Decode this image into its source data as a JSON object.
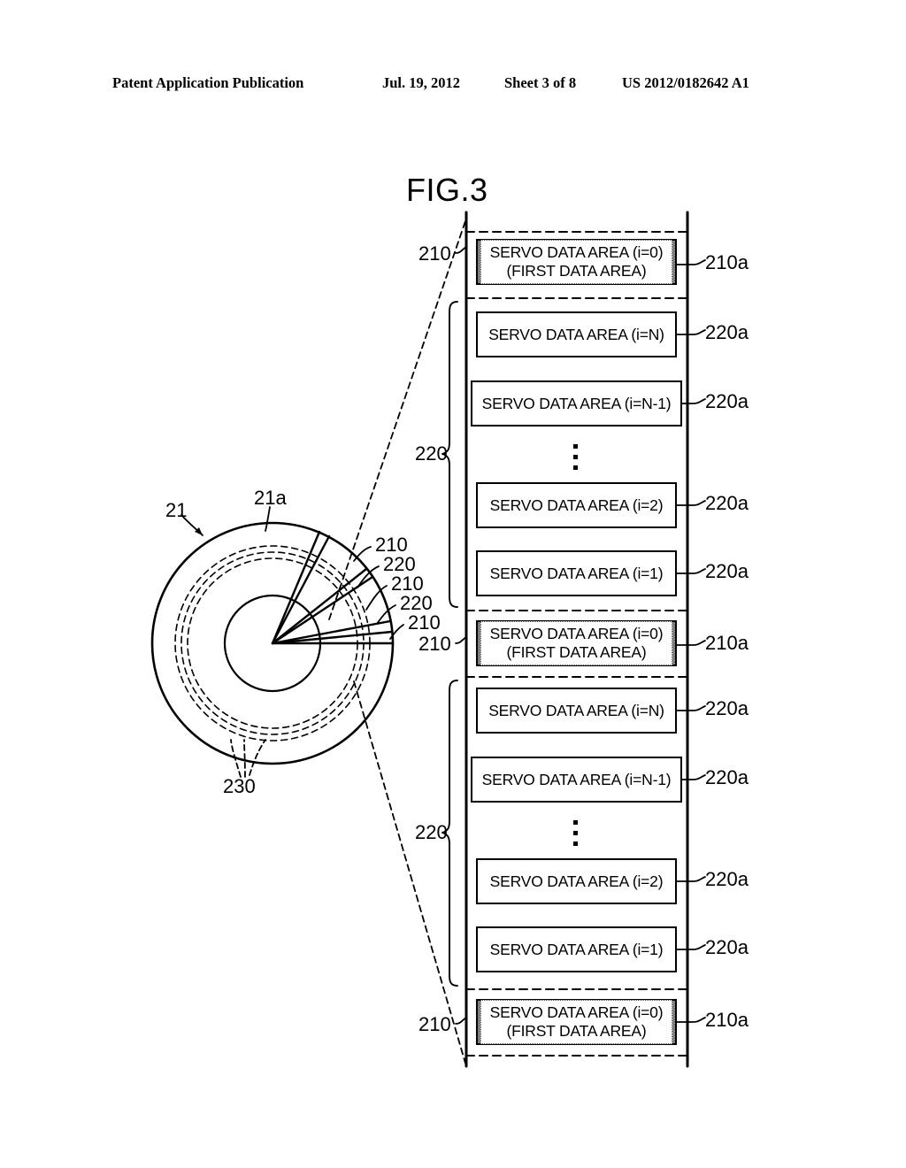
{
  "header": {
    "publication": "Patent Application Publication",
    "date": "Jul. 19, 2012",
    "sheet": "Sheet 3 of 8",
    "patent_number": "US 2012/0182642 A1"
  },
  "figure": {
    "title": "FIG.3"
  },
  "blocks": [
    {
      "id": "b1",
      "type": "shaded",
      "line1": "SERVO DATA AREA (i=0)",
      "line2": "(FIRST DATA AREA)",
      "right_label": "210a",
      "left_label": "210"
    },
    {
      "id": "b2",
      "type": "plain",
      "line1": "SERVO DATA AREA (i=N)",
      "right_label": "220a"
    },
    {
      "id": "b3",
      "type": "plain",
      "line1": "SERVO DATA AREA (i=N-1)",
      "right_label": "220a"
    },
    {
      "id": "b4",
      "type": "ellipsis"
    },
    {
      "id": "b5",
      "type": "plain",
      "line1": "SERVO DATA AREA (i=2)",
      "right_label": "220a"
    },
    {
      "id": "b6",
      "type": "plain",
      "line1": "SERVO DATA AREA (i=1)",
      "right_label": "220a"
    },
    {
      "id": "b7",
      "type": "shaded",
      "line1": "SERVO DATA AREA (i=0)",
      "line2": "(FIRST DATA AREA)",
      "right_label": "210a",
      "left_label": "210"
    },
    {
      "id": "b8",
      "type": "plain",
      "line1": "SERVO DATA AREA (i=N)",
      "right_label": "220a"
    },
    {
      "id": "b9",
      "type": "plain",
      "line1": "SERVO DATA AREA (i=N-1)",
      "right_label": "220a"
    },
    {
      "id": "b10",
      "type": "ellipsis"
    },
    {
      "id": "b11",
      "type": "plain",
      "line1": "SERVO DATA AREA (i=2)",
      "right_label": "220a"
    },
    {
      "id": "b12",
      "type": "plain",
      "line1": "SERVO DATA AREA (i=1)",
      "right_label": "220a"
    },
    {
      "id": "b13",
      "type": "shaded",
      "line1": "SERVO DATA AREA (i=0)",
      "line2": "(FIRST DATA AREA)",
      "right_label": "210a",
      "left_label": "210"
    }
  ],
  "group_brackets": [
    {
      "id": "g1",
      "label": "220"
    },
    {
      "id": "g2",
      "label": "220"
    }
  ],
  "disk": {
    "labels": {
      "disk": "21",
      "surface": "21a",
      "track": "230"
    },
    "sector_labels": [
      "210",
      "220",
      "210",
      "220",
      "210"
    ]
  }
}
